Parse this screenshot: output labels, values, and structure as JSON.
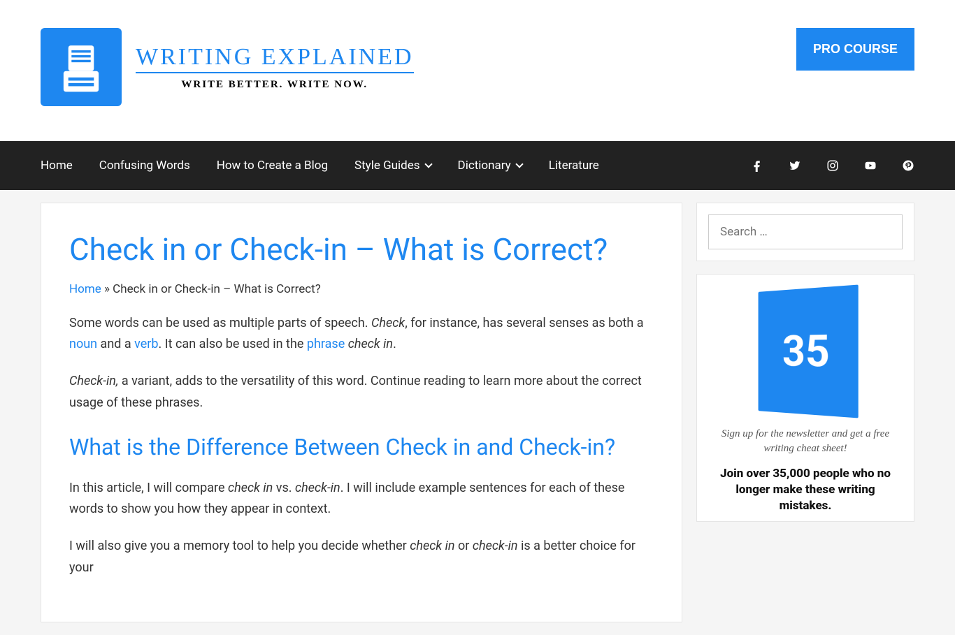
{
  "header": {
    "site_title": "WRITING EXPLAINED",
    "tagline": "WRITE BETTER. WRITE NOW.",
    "pro_button": "PRO COURSE"
  },
  "nav": {
    "items": [
      {
        "label": "Home",
        "dropdown": false
      },
      {
        "label": "Confusing Words",
        "dropdown": false
      },
      {
        "label": "How to Create a Blog",
        "dropdown": false
      },
      {
        "label": "Style Guides",
        "dropdown": true
      },
      {
        "label": "Dictionary",
        "dropdown": true
      },
      {
        "label": "Literature",
        "dropdown": false
      }
    ]
  },
  "article": {
    "title": "Check in or Check-in – What is Correct?",
    "breadcrumb_home": "Home",
    "breadcrumb_sep": " » ",
    "breadcrumb_current": "Check in or Check-in – What is Correct?",
    "p1_a": "Some words can be used as multiple parts of speech. ",
    "p1_b": "Check",
    "p1_c": ", for instance, has several senses as both a ",
    "p1_noun": "noun",
    "p1_d": " and a ",
    "p1_verb": "verb",
    "p1_e": ". It can also be used in the ",
    "p1_phrase": "phrase",
    "p1_f": " ",
    "p1_g": "check in",
    "p1_h": ".",
    "p2_a": "Check-in,",
    "p2_b": " a variant, adds to the versatility of this word. Continue reading to learn more about the correct usage of these phrases.",
    "h2": "What is the Difference Between Check in and Check-in?",
    "p3_a": "In this article, I will compare ",
    "p3_b": "check in",
    "p3_c": " vs. ",
    "p3_d": "check-in",
    "p3_e": ". I will include example sentences for each of these words to show you how they appear in context.",
    "p4_a": "I will also give you a memory tool to help you decide whether ",
    "p4_b": "check in",
    "p4_c": " or ",
    "p4_d": "check-in",
    "p4_e": " is a better choice for your"
  },
  "sidebar": {
    "search_placeholder": "Search …",
    "promo_num": "35",
    "promo_caption": "Sign up for the newsletter and get a free writing cheat sheet!",
    "promo_bold": "Join over 35,000 people who no longer make these writing mistakes."
  }
}
